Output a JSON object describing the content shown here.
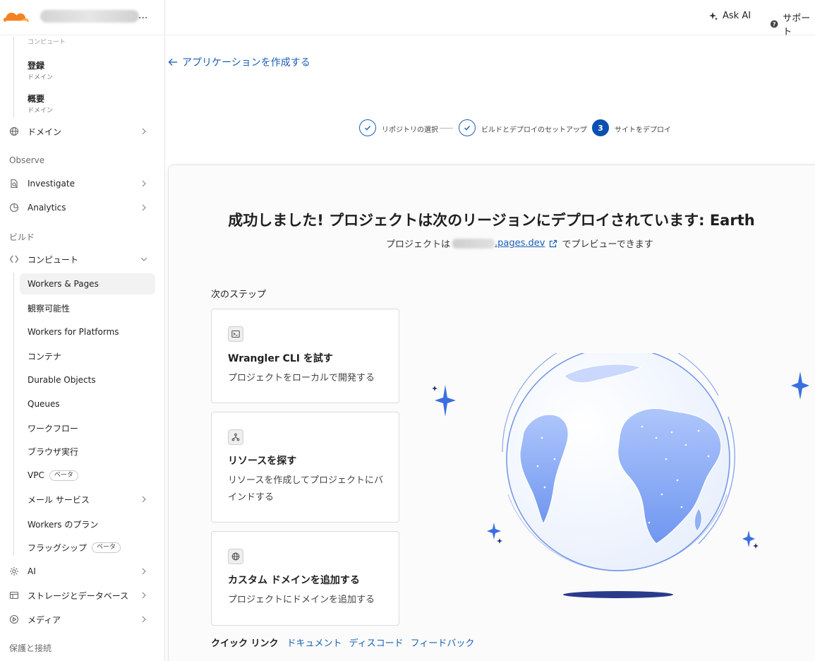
{
  "sidebar": {
    "clipped_label": "コンピュート",
    "sub_items": [
      {
        "title": "登録",
        "subtitle": "ドメイン"
      },
      {
        "title": "概要",
        "subtitle": "ドメイン"
      }
    ],
    "domains_label": "ドメイン",
    "observe_heading": "Observe",
    "investigate_label": "Investigate",
    "analytics_label": "Analytics",
    "build_heading": "ビルド",
    "compute_label": "コンピュート",
    "compute_children": [
      {
        "label": "Workers & Pages",
        "badge": "",
        "active": true
      },
      {
        "label": "観察可能性",
        "badge": ""
      },
      {
        "label": "Workers for Platforms",
        "badge": ""
      },
      {
        "label": "コンテナ",
        "badge": ""
      },
      {
        "label": "Durable Objects",
        "badge": ""
      },
      {
        "label": "Queues",
        "badge": ""
      },
      {
        "label": "ワークフロー",
        "badge": ""
      },
      {
        "label": "ブラウザ実行",
        "badge": ""
      },
      {
        "label": "VPC",
        "badge": "ベータ"
      },
      {
        "label": "メール サービス",
        "badge": ""
      },
      {
        "label": "Workers のプラン",
        "badge": ""
      },
      {
        "label": "フラッグシップ",
        "badge": "ベータ"
      }
    ],
    "ai_label": "AI",
    "storage_label": "ストレージとデータベース",
    "media_label": "メディア",
    "protect_heading": "保護と接続",
    "account_ellipsis": "..."
  },
  "topbar": {
    "ask_ai": "Ask AI",
    "support": "サポート"
  },
  "main": {
    "back_link": "アプリケーションを作成する",
    "steps": [
      {
        "label": "リポジトリの選択",
        "state": "done"
      },
      {
        "label": "ビルドとデプロイのセットアップ",
        "state": "done"
      },
      {
        "label": "サイトをデプロイ",
        "state": "current",
        "number": "3"
      }
    ],
    "success_title": "成功しました! プロジェクトは次のリージョンにデプロイされています: Earth",
    "preview_prefix": "プロジェクトは",
    "preview_domain": ".pages.dev",
    "preview_suffix": "でプレビューできます",
    "next_steps_heading": "次のステップ",
    "next_steps": [
      {
        "icon": "terminal-icon",
        "title": "Wrangler CLI を試す",
        "description": "プロジェクトをローカルで開発する"
      },
      {
        "icon": "resource-icon",
        "title": "リソースを探す",
        "description": "リソースを作成してプロジェクトにバインドする"
      },
      {
        "icon": "globe-icon",
        "title": "カスタム ドメインを追加する",
        "description": "プロジェクトにドメインを追加する"
      }
    ],
    "quick_links_label": "クイック リンク",
    "quick_links": [
      "ドキュメント",
      "ディスコード",
      "フィードバック"
    ]
  },
  "colors": {
    "link": "#1a5fb4",
    "step_active": "#0b4fb3",
    "brand_orange": "#f48120"
  }
}
